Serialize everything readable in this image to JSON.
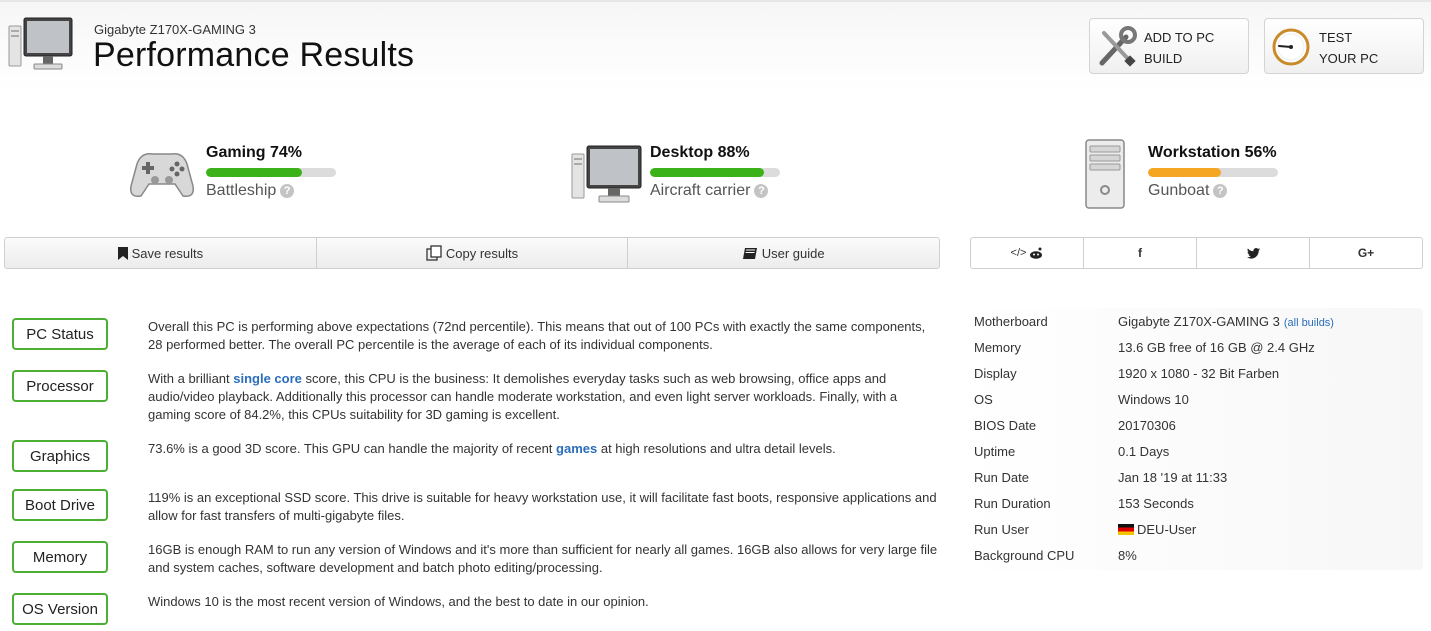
{
  "header": {
    "subtitle": "Gigabyte Z170X-GAMING 3",
    "title": "Performance Results",
    "add_build_line1": "ADD TO PC",
    "add_build_line2": "BUILD",
    "test_line1": "TEST",
    "test_line2": "YOUR PC",
    "icons": [
      "desktop-icon",
      "tools-icon",
      "gauge-icon"
    ]
  },
  "scores": {
    "gaming": {
      "label": "Gaming 74%",
      "percent": 74,
      "rank": "Battleship",
      "color": "#3cb21a",
      "icon": "gamepad-icon"
    },
    "desktop": {
      "label": "Desktop 88%",
      "percent": 88,
      "rank": "Aircraft carrier",
      "color": "#3cb21a",
      "icon": "monitor-icon"
    },
    "workstation": {
      "label": "Workstation 56%",
      "percent": 56,
      "rank": "Gunboat",
      "color": "#f5a623",
      "icon": "server-tower-icon"
    }
  },
  "actions": {
    "save": "Save results",
    "copy": "Copy results",
    "guide": "User guide"
  },
  "share": {
    "embed": "</>",
    "facebook": "f",
    "twitter": "twitter",
    "googleplus": "G+"
  },
  "rows": {
    "pc_status": {
      "label": "PC Status",
      "text": "Overall this PC is performing above expectations (72nd percentile). This means that out of 100 PCs with exactly the same components, 28 performed better. The overall PC percentile is the average of each of its individual components."
    },
    "processor": {
      "label": "Processor",
      "text_before": "With a brilliant ",
      "link": "single core",
      "text_after": " score, this CPU is the business: It demolishes everyday tasks such as web browsing, office apps and audio/video playback. Additionally this processor can handle moderate workstation, and even light server workloads. Finally, with a gaming score of 84.2%, this CPUs suitability for 3D gaming is excellent."
    },
    "graphics": {
      "label": "Graphics",
      "text_before": "73.6% is a good 3D score. This GPU can handle the majority of recent ",
      "link": "games",
      "text_after": " at high resolutions and ultra detail levels."
    },
    "boot_drive": {
      "label": "Boot Drive",
      "text": "119% is an exceptional SSD score. This drive is suitable for heavy workstation use, it will facilitate fast boots, responsive applications and allow for fast transfers of multi-gigabyte files."
    },
    "memory": {
      "label": "Memory",
      "text": "16GB is enough RAM to run any version of Windows and it's more than sufficient for nearly all games. 16GB also allows for very large file and system caches, software development and batch photo editing/processing."
    },
    "os_version": {
      "label": "OS Version",
      "text": "Windows 10 is the most recent version of Windows, and the best to date in our opinion."
    }
  },
  "specs": [
    {
      "key": "Motherboard",
      "value": "Gigabyte Z170X-GAMING 3",
      "link": "(all builds)"
    },
    {
      "key": "Memory",
      "value": "13.6 GB free of 16 GB @ 2.4 GHz"
    },
    {
      "key": "Display",
      "value": "1920 x 1080 - 32 Bit Farben"
    },
    {
      "key": "OS",
      "value": "Windows 10"
    },
    {
      "key": "BIOS Date",
      "value": "20170306"
    },
    {
      "key": "Uptime",
      "value": "0.1 Days"
    },
    {
      "key": "Run Date",
      "value": "Jan 18 '19 at 11:33"
    },
    {
      "key": "Run Duration",
      "value": "153 Seconds"
    },
    {
      "key": "Run User",
      "value": "DEU-User",
      "flag": "germany-flag-icon"
    },
    {
      "key": "Background CPU",
      "value": "8%"
    }
  ]
}
